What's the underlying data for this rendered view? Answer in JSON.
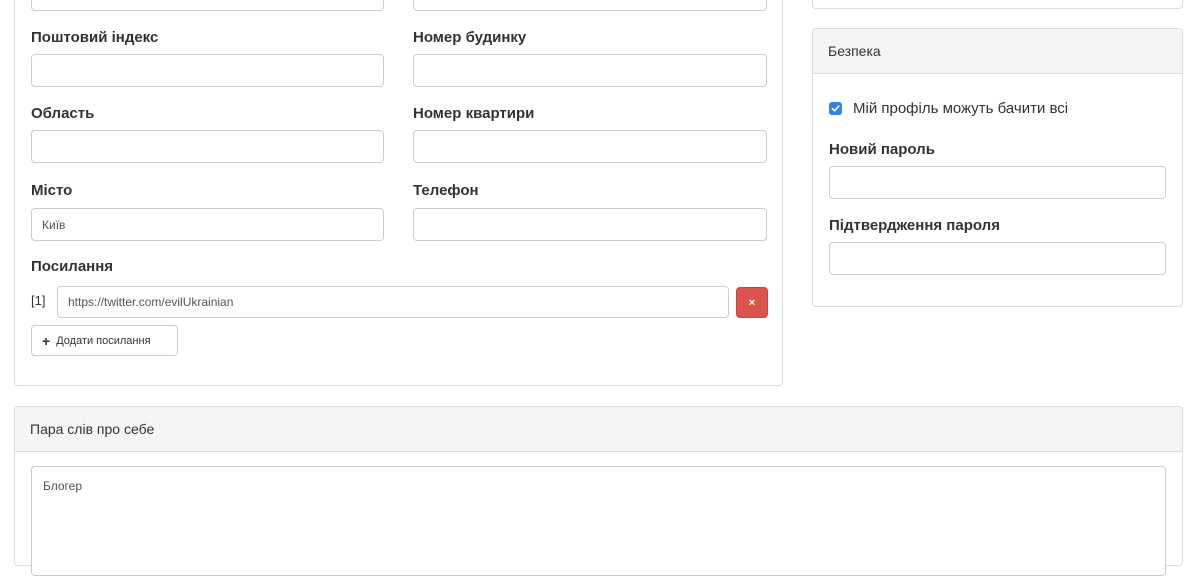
{
  "address": {
    "postal_code_label": "Поштовий індекс",
    "house_number_label": "Номер будинку",
    "region_label": "Область",
    "apartment_label": "Номер квартири",
    "city_label": "Місто",
    "city_value": "Київ",
    "phone_label": "Телефон"
  },
  "links": {
    "heading": "Посилання",
    "items": [
      {
        "index": "[1]",
        "url": "https://twitter.com/evilUkrainian"
      }
    ],
    "remove_icon": "times-icon",
    "remove_glyph": "×",
    "add_icon": "plus-icon",
    "add_glyph": "+",
    "add_label": "Додати посилання"
  },
  "security": {
    "title": "Безпека",
    "public_profile_label": "Мій профіль можуть бачити всі",
    "public_profile_checked": true,
    "new_password_label": "Новий пароль",
    "confirm_password_label": "Підтвердження пароля"
  },
  "about": {
    "title": "Пара слів про себе",
    "value": "Блогер"
  },
  "colors": {
    "accent": "#2f86e8",
    "danger": "#d9534f",
    "panel_heading_bg": "#f5f5f5",
    "border": "#dcdcdc"
  }
}
